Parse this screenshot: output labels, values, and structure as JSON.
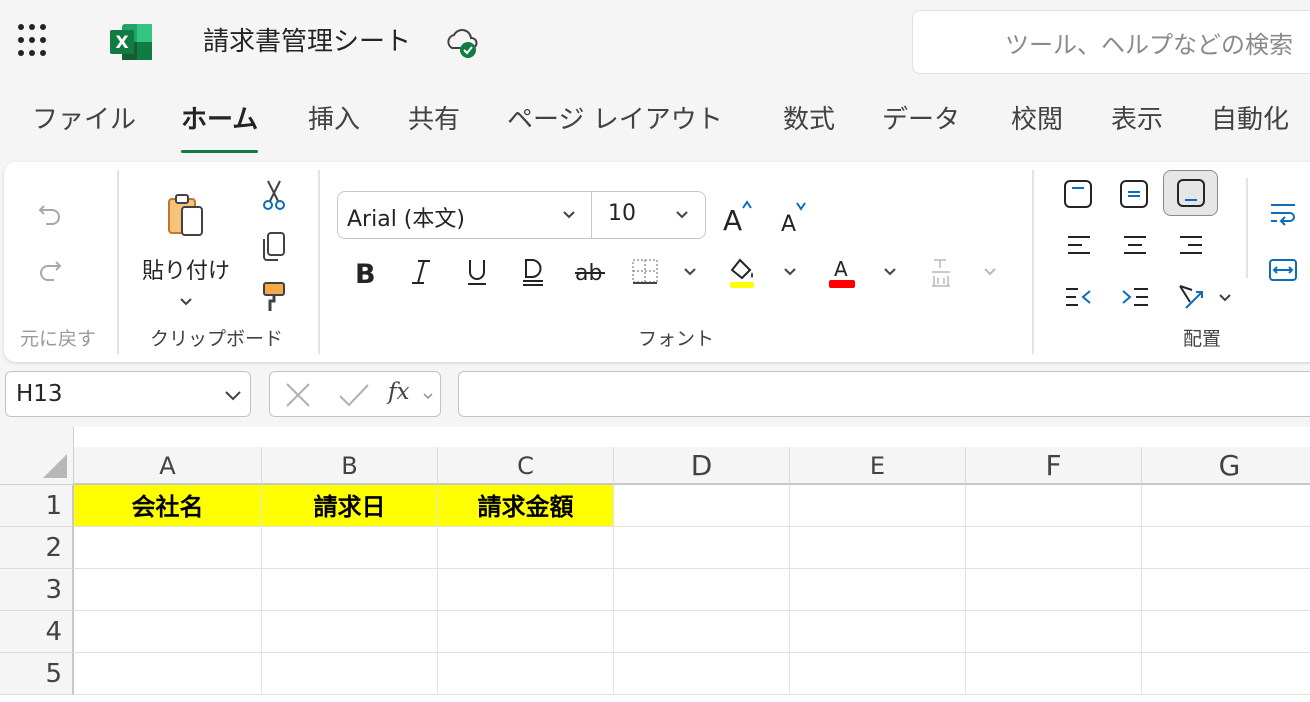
{
  "app": {
    "title": "請求書管理シート",
    "search_placeholder": "ツール、ヘルプなどの検索",
    "brand_color": "#107c41"
  },
  "tabs": [
    {
      "label": "ファイル"
    },
    {
      "label": "ホーム",
      "active": true
    },
    {
      "label": "挿入"
    },
    {
      "label": "共有"
    },
    {
      "label": "ページ レイアウト"
    },
    {
      "label": "数式"
    },
    {
      "label": "データ"
    },
    {
      "label": "校閲"
    },
    {
      "label": "表示"
    },
    {
      "label": "自動化"
    }
  ],
  "ribbon": {
    "undo_group_label": "元に戻す",
    "clipboard": {
      "paste_label": "貼り付け",
      "group_label": "クリップボード"
    },
    "font": {
      "name": "Arial (本文)",
      "size": "10",
      "group_label": "フォント",
      "highlight_color": "#ffff00",
      "font_color": "#ff0000"
    },
    "alignment": {
      "group_label": "配置"
    }
  },
  "formula_bar": {
    "name_box": "H13",
    "fx_label": "fx",
    "formula": ""
  },
  "sheet": {
    "columns": [
      "A",
      "B",
      "C",
      "D",
      "E",
      "F",
      "G"
    ],
    "rows": [
      "1",
      "2",
      "3",
      "4",
      "5"
    ],
    "header_fill": "#ffff00",
    "cells": {
      "A1": "会社名",
      "B1": "請求日",
      "C1": "請求金額"
    }
  }
}
